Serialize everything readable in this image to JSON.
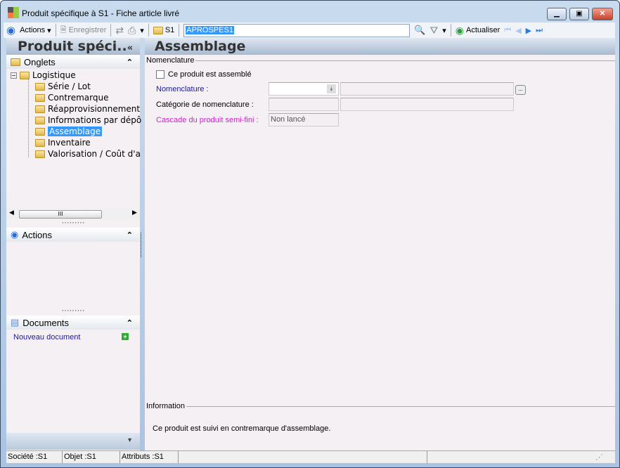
{
  "window": {
    "title": "Produit spécifique à S1 -  Fiche article livré"
  },
  "toolbar": {
    "actions": "Actions",
    "save": "Enregistrer",
    "folder_label": "S1",
    "search_value": "APROSPES1",
    "refresh": "Actualiser"
  },
  "left": {
    "title": "Produit spéci..",
    "collapse": "«",
    "onglets": {
      "label": "Onglets",
      "root": "Logistique",
      "items": [
        "Série / Lot",
        "Contremarque",
        "Réapprovisionnement",
        "Informations par dépô",
        "Assemblage",
        "Inventaire",
        "Valorisation / Coût d'a"
      ],
      "selected": "Assemblage"
    },
    "actions": {
      "label": "Actions"
    },
    "documents": {
      "label": "Documents",
      "new": "Nouveau document"
    }
  },
  "main": {
    "title": "Assemblage",
    "nomenclature_group": "Nomenclature",
    "checkbox_label": "Ce produit est assemblé",
    "checkbox_checked": false,
    "nomenclature_label": "Nomenclature :",
    "nomenclature_value": "",
    "categorie_label": "Catégorie de nomenclature :",
    "cascade_label": "Cascade du produit semi-fini :",
    "cascade_value": "Non lancé",
    "information_group": "Information",
    "information_text": "Ce produit est suivi en contremarque d'assemblage."
  },
  "status": {
    "societe": "Société :S1",
    "objet": "Objet :S1",
    "attributs": "Attributs :S1"
  },
  "colors": {
    "link": "#1a1aa6",
    "magenta": "#cc22cc",
    "selection": "#3399ff"
  }
}
